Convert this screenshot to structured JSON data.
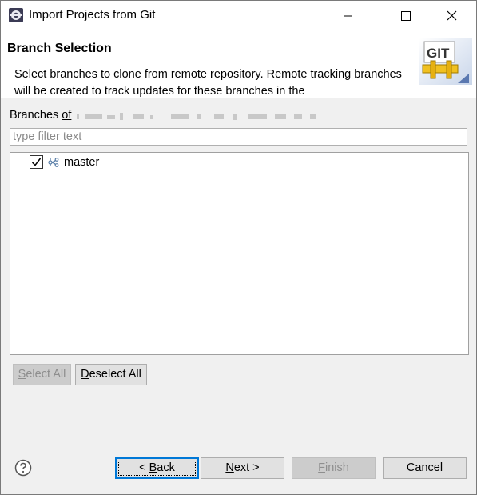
{
  "window": {
    "title": "Import Projects from Git"
  },
  "banner": {
    "title": "Branch Selection",
    "description": "Select branches to clone from remote repository. Remote tracking branches will be created to track updates for these branches in the",
    "logo_text": "GIT"
  },
  "branches": {
    "label_prefix": "Branches ",
    "label_mnemonic": "of",
    "filter_placeholder": "type filter text",
    "items": [
      {
        "label": "master",
        "checked": true,
        "icon": "branch-icon"
      }
    ]
  },
  "selection_buttons": {
    "select_all_mnemonic": "S",
    "select_all_rest": "elect All",
    "deselect_all_mnemonic": "D",
    "deselect_all_rest": "eselect All"
  },
  "footer": {
    "help_icon": "question-mark-circle-icon",
    "back_prefix": "< ",
    "back_mnemonic": "B",
    "back_rest": "ack",
    "next_mnemonic": "N",
    "next_rest": "ext >",
    "finish_mnemonic": "F",
    "finish_rest": "inish",
    "cancel_label": "Cancel"
  },
  "colors": {
    "dialog_bg": "#f0f0f0",
    "banner_bg": "#ffffff",
    "default_button_border": "#0078d7",
    "disabled_text": "#8e8e8e"
  }
}
